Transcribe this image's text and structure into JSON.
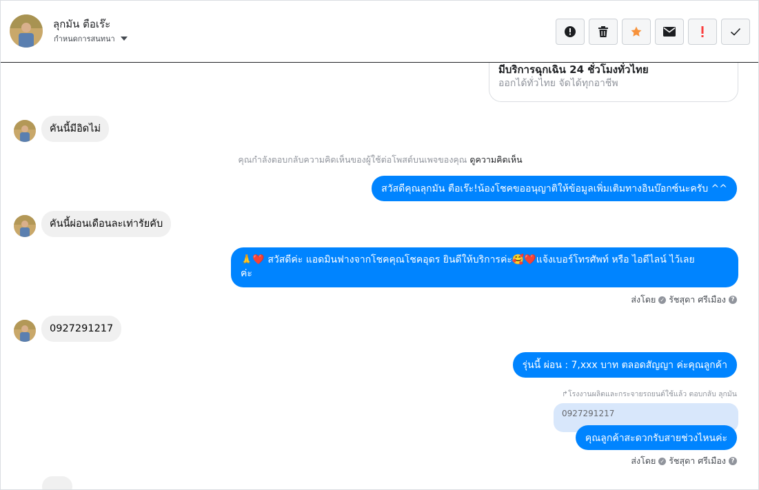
{
  "header": {
    "contact_name": "ลุกมัน ตือเร๊ะ",
    "assign_label": "กำหนดการสนทนา",
    "actions": [
      {
        "name": "report-spam-button",
        "icon": "alert-circle-icon",
        "color": "#1c1e21"
      },
      {
        "name": "delete-button",
        "icon": "trash-icon",
        "color": "#1c1e21"
      },
      {
        "name": "star-button",
        "icon": "star-icon",
        "color": "#f7923b"
      },
      {
        "name": "mark-unread-button",
        "icon": "envelope-icon",
        "color": "#1c1e21"
      },
      {
        "name": "mark-important-button",
        "icon": "exclamation-icon",
        "color": "#fa3e3e"
      },
      {
        "name": "mark-done-button",
        "icon": "check-icon",
        "color": "#1c1e21"
      }
    ]
  },
  "card": {
    "title": "มีบริการฉุกเฉิน 24 ชั่วโมงทั่วไทย",
    "subtitle": "ออกได้ทั่วไทย จัดได้ทุกอาชีพ"
  },
  "messages": {
    "in1": "คันนี้มีอิดไม่",
    "notice_text": "คุณกำลังตอบกลับความคิดเห็นของผู้ใช้ต่อโพสต์บนเพจของคุณ",
    "notice_link": "ดูความคิดเห็น",
    "out1": "สวัสดีคุณลุกมัน ตือเร๊ะ!น้องโชคขออนุญาติให้ข้อมูลเพิ่มเติมทางอินบ๊อกซ์นะครับ ^^",
    "in2": "คันนี้ผ่อนเดือนละเท่ารัยคับ",
    "out2_line1": "🙏❤️ สวัสดีค่ะ แอดมินฟางจากโชคคุณโชคอุดร ยินดีให้บริการค่ะ🥰❤️แจ้งเบอร์โทรศัพท์ หรือ ไอดีไลน์  ไว้เลย",
    "out2_line2": "ค่ะ",
    "sent_by_label": "ส่งโดย",
    "sender_name": "รัชสุดา ศรีเมือง",
    "in3": "0927291217",
    "out3": "รุ่นนี้ ผ่อน : 7,xxx บาท ตลอดสัญญา  ค่ะคุณลูกค้า",
    "reply_context": "โรงงานผลิตและกระจายรถยนต์ใช้แล้ว ตอบกลับ ลุกมัน",
    "quoted_text": "0927291217",
    "out4": "คุณลูกค้าสะดวกรับสายช่วงไหนค่ะ"
  },
  "colors": {
    "outgoing": "#0084ff",
    "incoming": "#f0f0f0",
    "quote": "#d8e7fb"
  }
}
